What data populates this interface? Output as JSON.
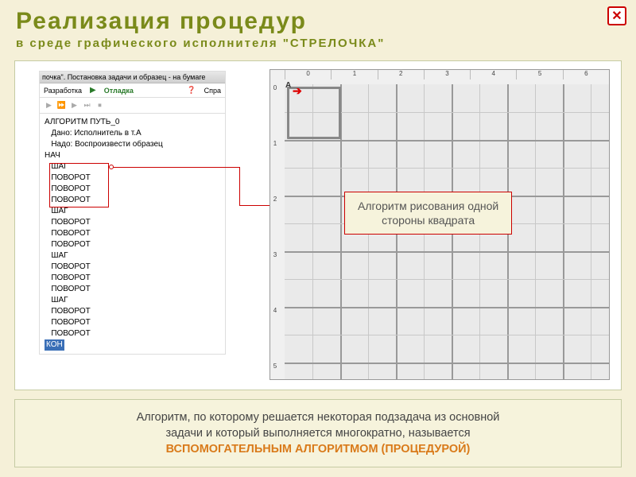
{
  "header": {
    "title": "Реализация  процедур",
    "subtitle": "в  среде  графического  исполнителя  \"СТРЕЛОЧКА\""
  },
  "close_icon": "✕",
  "panel": {
    "window_title": "почка\". Постановка задачи и образец - на бумаге",
    "tb_dev": "Разработка",
    "tb_run": "Отладка",
    "tb_help": "Спра",
    "code": [
      "АЛГОРИТМ ПУТЬ_0",
      "   Дано: Исполнитель в т.А",
      "   Надо: Воспроизвести образец",
      "НАЧ",
      "   ШАГ",
      "   ПОВОРОТ",
      "   ПОВОРОТ",
      "   ПОВОРОТ",
      "   ШАГ",
      "   ПОВОРОТ",
      "   ПОВОРОТ",
      "   ПОВОРОТ",
      "   ШАГ",
      "   ПОВОРОТ",
      "   ПОВОРОТ",
      "   ПОВОРОТ",
      "   ШАГ",
      "   ПОВОРОТ",
      "   ПОВОРОТ",
      "   ПОВОРОТ"
    ],
    "code_last": "КОН"
  },
  "grid": {
    "top_labels": [
      "0",
      "1",
      "2",
      "3",
      "4",
      "5",
      "6"
    ],
    "left_labels": [
      "0",
      "1",
      "2",
      "3",
      "4",
      "5"
    ],
    "point": "А",
    "arrow": "➔"
  },
  "callout": {
    "l1": "Алгоритм рисования одной",
    "l2": "стороны квадрата"
  },
  "footer": {
    "t1": "Алгоритм, по которому решается некоторая подзадача из основной",
    "t2": "задачи и который выполняется многократно, называется",
    "t3": "ВСПОМОГАТЕЛЬНЫМ АЛГОРИТМОМ (ПРОЦЕДУРОЙ)"
  }
}
